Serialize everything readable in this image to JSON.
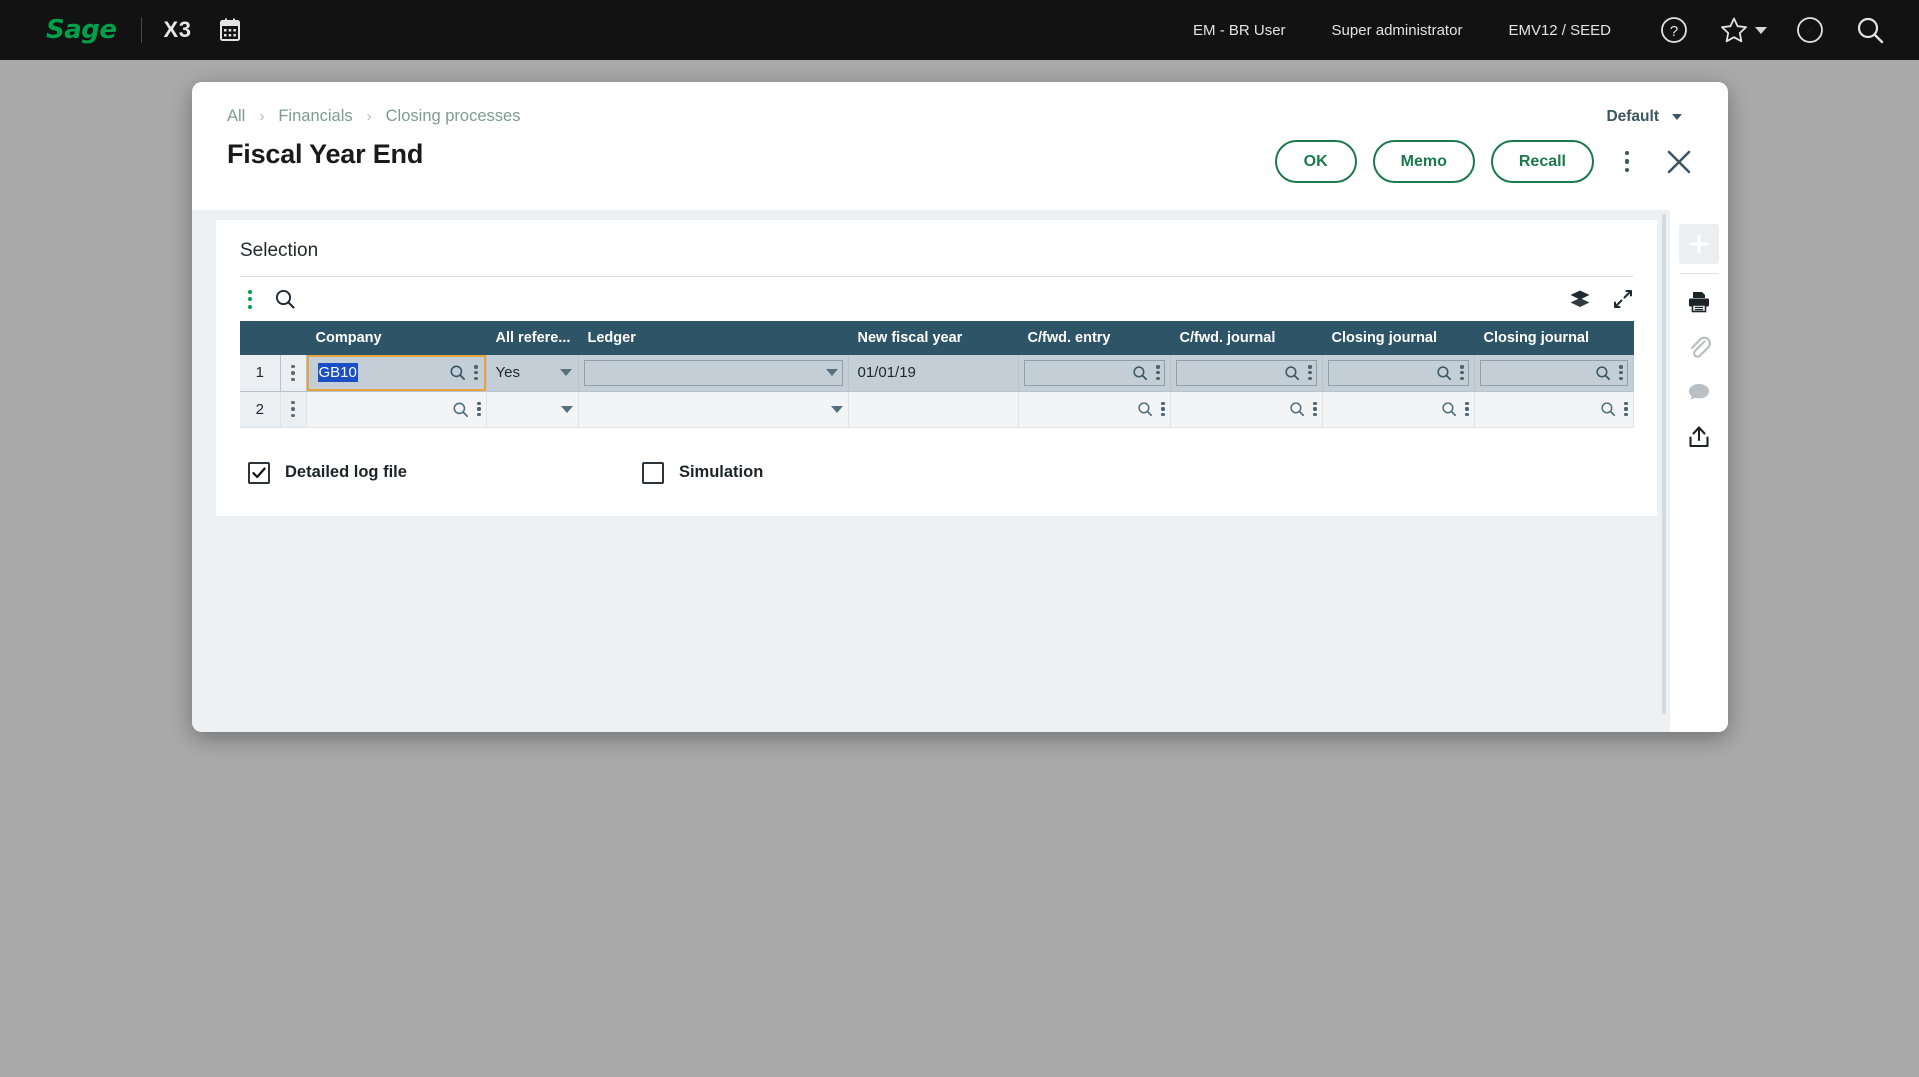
{
  "topbar": {
    "brand": "Sage",
    "product": "X3",
    "calendar_icon": "calendar-icon",
    "user_entity": "EM - BR User",
    "role": "Super administrator",
    "environment": "EMV12 / SEED",
    "icons": [
      "help-icon",
      "favorites-star-icon",
      "chevron-down-icon",
      "compass-icon",
      "search-icon"
    ]
  },
  "modal": {
    "breadcrumb": [
      {
        "label": "All"
      },
      {
        "label": "Financials"
      },
      {
        "label": "Closing processes"
      }
    ],
    "breadcrumb_separator": "›",
    "default_selector": "Default",
    "title": "Fiscal Year End",
    "actions": [
      {
        "label": "OK",
        "name": "ok-button"
      },
      {
        "label": "Memo",
        "name": "memo-button"
      },
      {
        "label": "Recall",
        "name": "recall-button"
      }
    ],
    "more_menu": "more-options-icon",
    "close": "close-icon"
  },
  "panel": {
    "title": "Selection",
    "toolbar": {
      "menu_icon": "grid-options-icon",
      "search_icon": "grid-search-icon",
      "layers_icon": "layers-icon",
      "expand_icon": "expand-icon"
    },
    "grid": {
      "columns": [
        {
          "key": "num",
          "label": ""
        },
        {
          "key": "kebab",
          "label": ""
        },
        {
          "key": "company",
          "label": "Company"
        },
        {
          "key": "allref",
          "label": "All refere..."
        },
        {
          "key": "ledger",
          "label": "Ledger"
        },
        {
          "key": "newfy",
          "label": "New fiscal year"
        },
        {
          "key": "cfwdentry",
          "label": "C/fwd. entry"
        },
        {
          "key": "cfwdjrnl",
          "label": "C/fwd. journal"
        },
        {
          "key": "closejrnl1",
          "label": "Closing journal"
        },
        {
          "key": "closejrnl2",
          "label": "Closing journal"
        }
      ],
      "rows": [
        {
          "num": "1",
          "company": "GB10",
          "company_selected": true,
          "company_focused": true,
          "allref": "Yes",
          "ledger": "",
          "newfy": "01/01/19",
          "cfwdentry": "",
          "cfwdjrnl": "",
          "closejrnl1": "",
          "closejrnl2": ""
        },
        {
          "num": "2",
          "company": "",
          "company_selected": false,
          "company_focused": false,
          "allref": "",
          "ledger": "",
          "newfy": "",
          "cfwdentry": "",
          "cfwdjrnl": "",
          "closejrnl1": "",
          "closejrnl2": ""
        }
      ]
    },
    "checkboxes": [
      {
        "label": "Detailed log file",
        "checked": true,
        "name": "detailed-log-file-checkbox"
      },
      {
        "label": "Simulation",
        "checked": false,
        "name": "simulation-checkbox"
      }
    ]
  },
  "rail": {
    "items": [
      {
        "name": "add-icon",
        "enabled": false
      },
      {
        "name": "print-icon",
        "enabled": true
      },
      {
        "name": "attachment-icon",
        "enabled": false
      },
      {
        "name": "comment-icon",
        "enabled": false
      },
      {
        "name": "share-icon",
        "enabled": true
      }
    ]
  },
  "colors": {
    "brand_green": "#00a04a",
    "action_green": "#1a7a4c",
    "grid_header": "#2d5567",
    "focus_amber": "#e8a33d",
    "selection_blue": "#1a4fc4",
    "topbar_black": "#121212",
    "backdrop_gray": "#a9a9a9"
  }
}
